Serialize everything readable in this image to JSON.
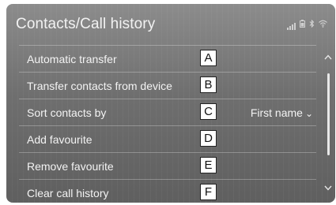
{
  "header": {
    "title": "Contacts/Call history",
    "status_icons": [
      "signal-icon",
      "battery-icon",
      "bluetooth-icon",
      "wifi-icon"
    ]
  },
  "menu": {
    "items": [
      {
        "label": "Automatic transfer",
        "marker": "A"
      },
      {
        "label": "Transfer contacts from device",
        "marker": "B"
      },
      {
        "label": "Sort contacts by",
        "marker": "C",
        "value": "First name"
      },
      {
        "label": "Add favourite",
        "marker": "D"
      },
      {
        "label": "Remove favourite",
        "marker": "E"
      },
      {
        "label": "Clear call history",
        "marker": "F"
      }
    ]
  },
  "icons": {
    "chevron": "chevron-down-icon",
    "scroll_up": "scroll-up-icon",
    "scroll_down": "scroll-down-icon"
  }
}
